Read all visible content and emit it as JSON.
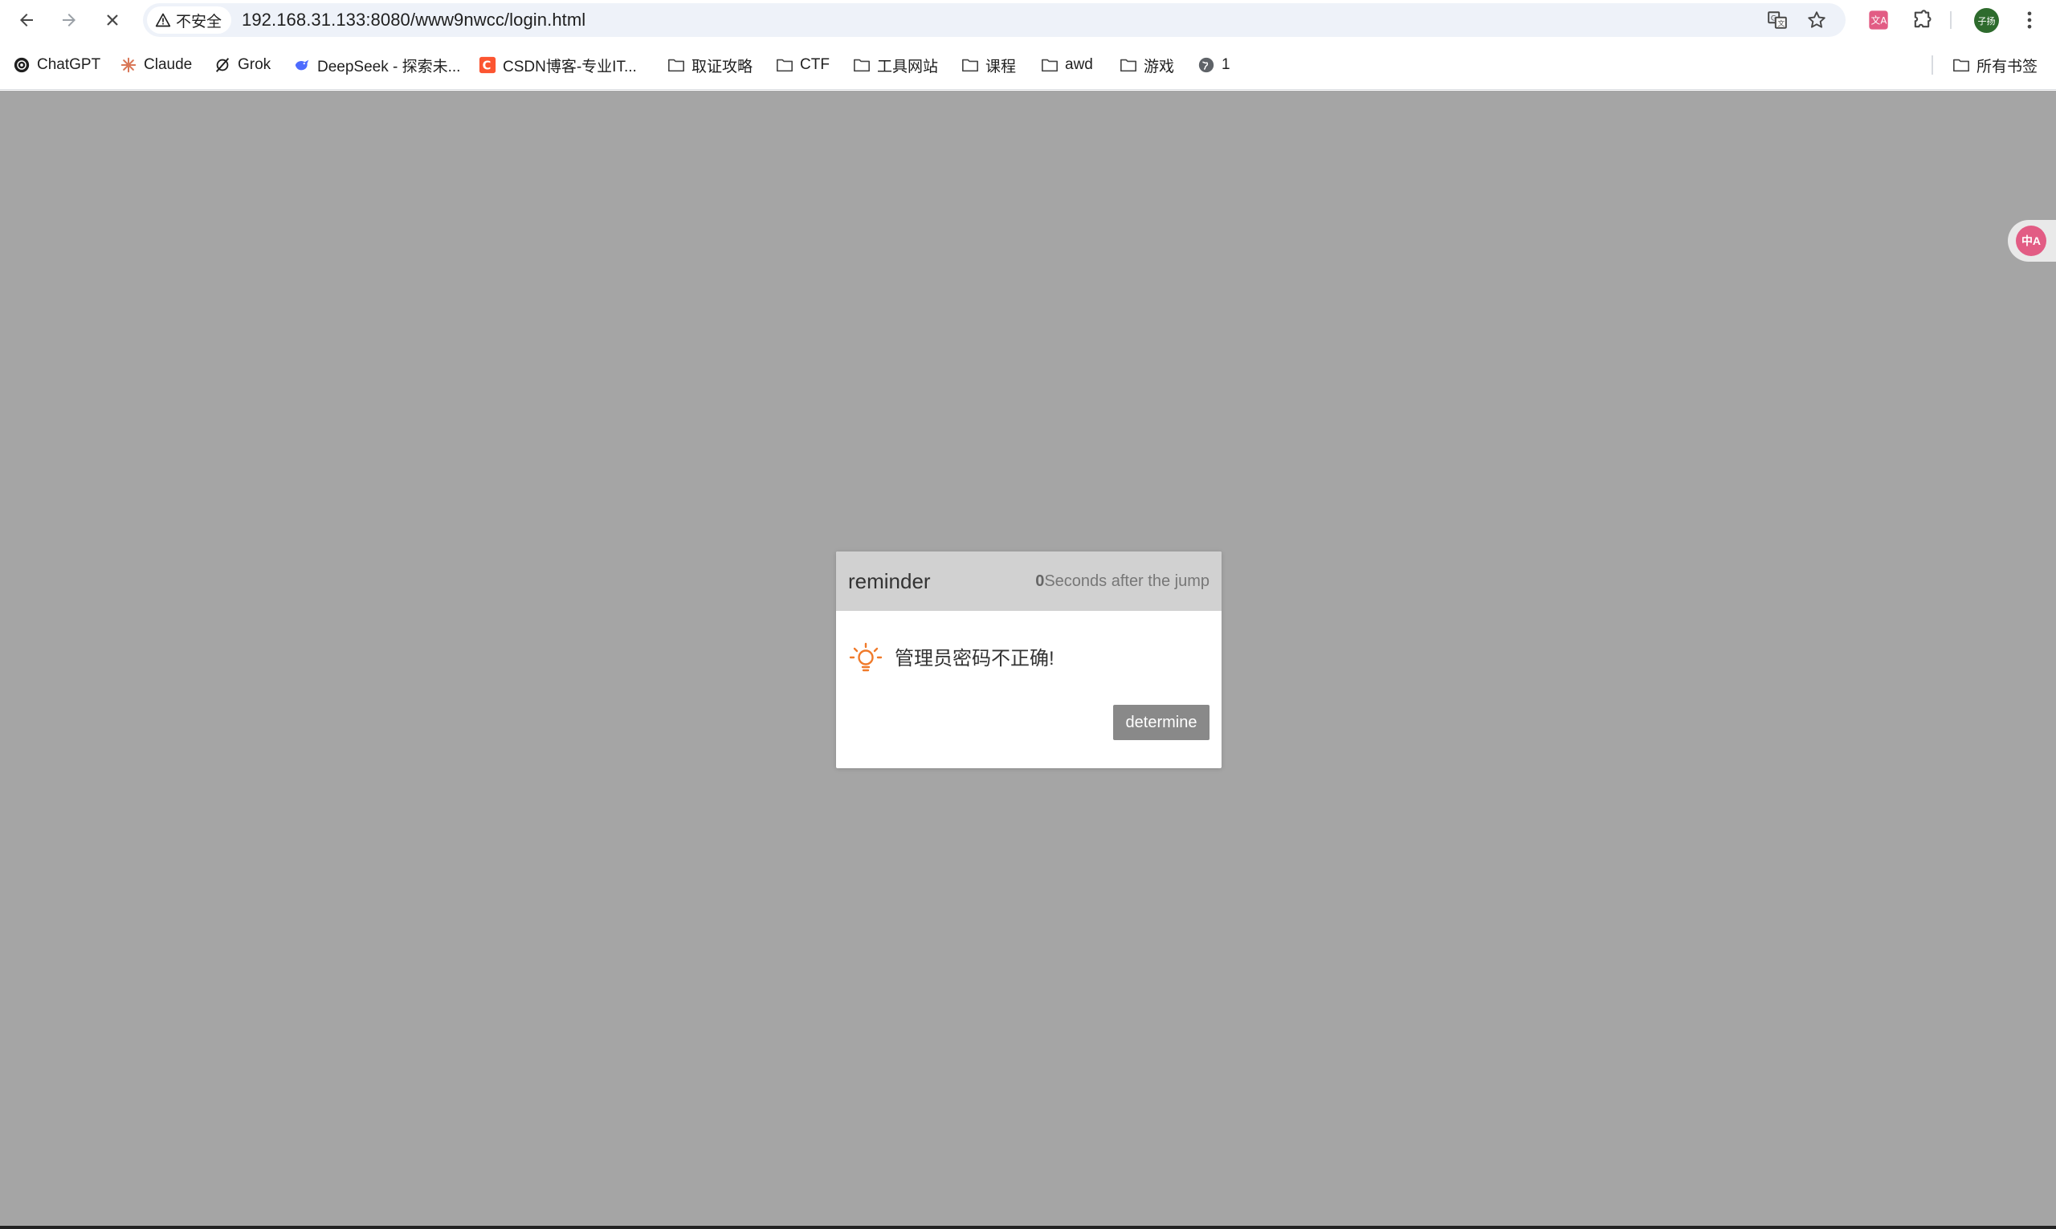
{
  "browser": {
    "security_label": "不安全",
    "url": "192.168.31.133:8080/www9nwcc/login.html",
    "profile_initials": "子扬",
    "bookmarks": [
      {
        "label": "ChatGPT",
        "icon": "chatgpt-icon"
      },
      {
        "label": "Claude",
        "icon": "claude-icon"
      },
      {
        "label": "Grok",
        "icon": "grok-icon"
      },
      {
        "label": "DeepSeek - 探索未...",
        "icon": "deepseek-icon"
      },
      {
        "label": "CSDN博客-专业IT...",
        "icon": "csdn-icon"
      },
      {
        "label": "取证攻略",
        "icon": "folder-icon"
      },
      {
        "label": "CTF",
        "icon": "folder-icon"
      },
      {
        "label": "工具网站",
        "icon": "folder-icon"
      },
      {
        "label": "课程",
        "icon": "folder-icon"
      },
      {
        "label": "awd",
        "icon": "folder-icon"
      },
      {
        "label": "游戏",
        "icon": "folder-icon"
      },
      {
        "label": "1",
        "icon": "globe-icon"
      }
    ],
    "all_bookmarks_label": "所有书签",
    "translate_float_label": "中A",
    "colors": {
      "omnibox_bg": "#eef2f9",
      "page_overlay": "#a5a5a5",
      "avatar": "#2e6b2d",
      "extension_pink": "#e25c84"
    }
  },
  "dialog": {
    "title": "reminder",
    "countdown_number": "0",
    "countdown_text": "Seconds after the jump",
    "message": "管理员密码不正确!",
    "confirm_label": "determine",
    "icon": "lightbulb-icon",
    "colors": {
      "header_bg": "#d1d1d1",
      "icon": "#f07a2a",
      "button_bg": "#898989"
    }
  }
}
